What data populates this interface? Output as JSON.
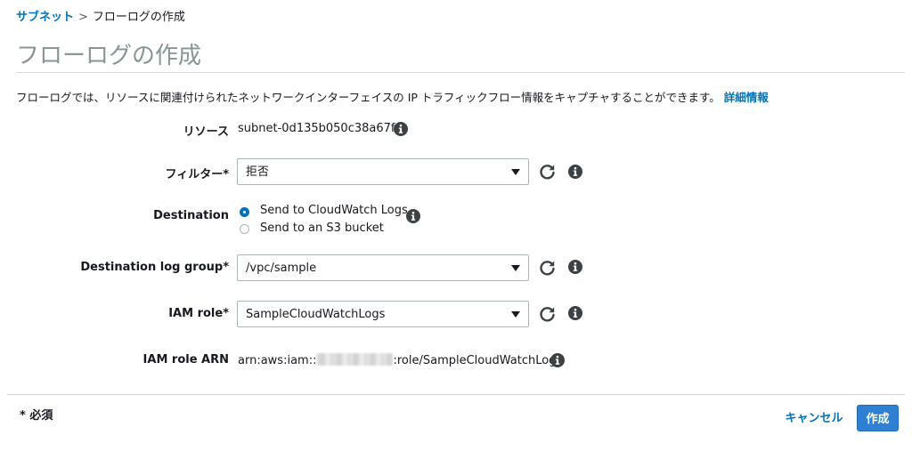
{
  "breadcrumb": {
    "parent": "サブネット",
    "separator": ">",
    "current": "フローログの作成"
  },
  "page_title": "フローログの作成",
  "description": {
    "text": "フローログでは、リソースに関連付けられたネットワークインターフェイスの IP トラフィックフロー情報をキャプチャすることができます。",
    "link": "詳細情報"
  },
  "form": {
    "resource": {
      "label": "リソース",
      "value": "subnet-0d135b050c38a67f0"
    },
    "filter": {
      "label": "フィルター*",
      "selected": "拒否"
    },
    "destination": {
      "label": "Destination",
      "options": [
        {
          "label": "Send to CloudWatch Logs",
          "checked": true
        },
        {
          "label": "Send to an S3 bucket",
          "checked": false
        }
      ]
    },
    "log_group": {
      "label": "Destination log group*",
      "selected": "/vpc/sample"
    },
    "iam_role": {
      "label": "IAM role*",
      "selected": "SampleCloudWatchLogs"
    },
    "iam_role_arn": {
      "label": "IAM role ARN",
      "prefix": "arn:aws:iam::",
      "suffix": ":role/SampleCloudWatchLogs"
    }
  },
  "footer": {
    "required_note": "* 必須",
    "cancel_label": "キャンセル",
    "create_label": "作成"
  },
  "colors": {
    "link": "#0073bb",
    "primary_button": "#2f7fd2",
    "title_gray": "#879596",
    "icon_dark": "#3c4143"
  },
  "icons": {
    "info": "info-icon",
    "refresh": "refresh-icon",
    "dropdown": "chevron-down-icon"
  }
}
